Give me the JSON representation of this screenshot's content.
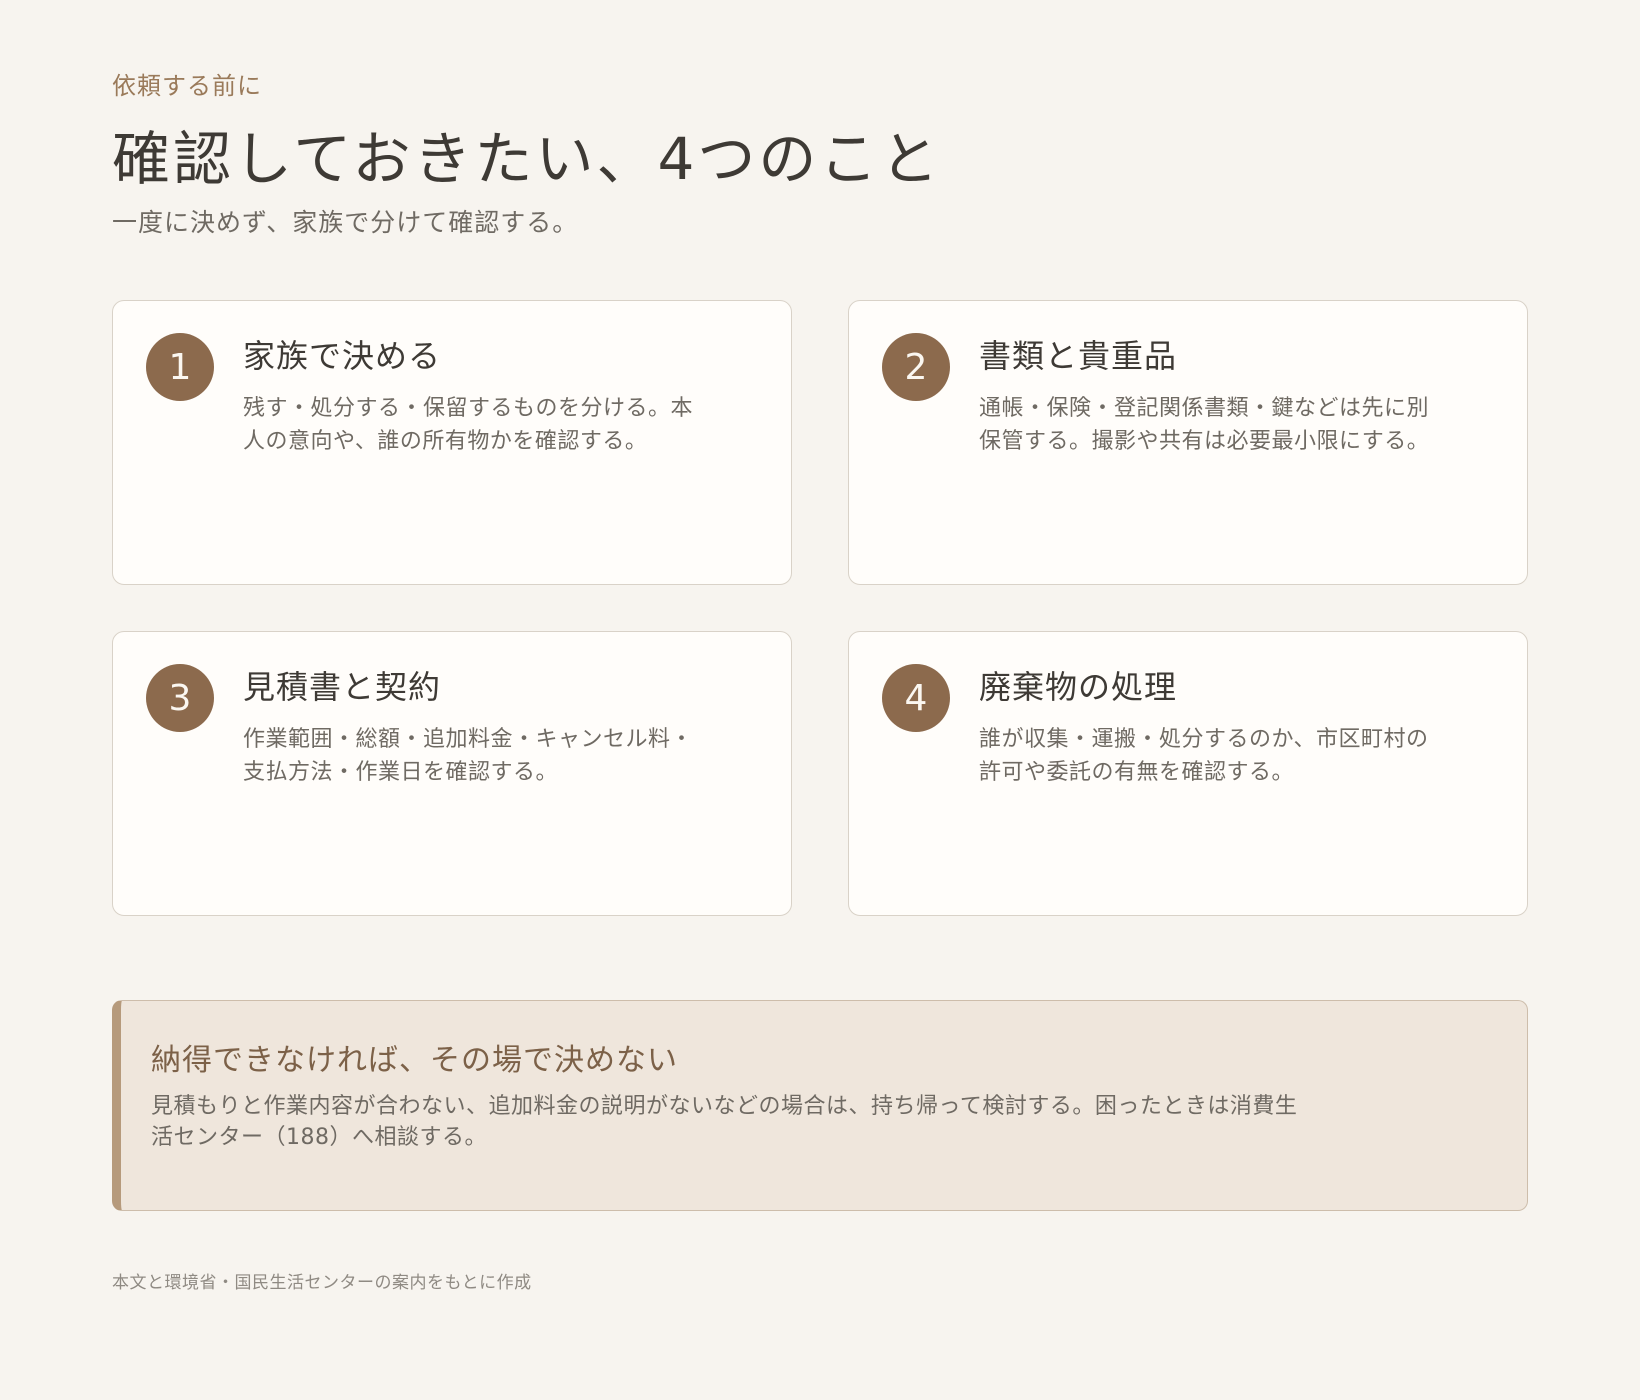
{
  "header": {
    "eyebrow": "依頼する前に",
    "title": "確認しておきたい、4つのこと",
    "subtitle": "一度に決めず、家族で分けて確認する。"
  },
  "cards": [
    {
      "number": "1",
      "title": "家族で決める",
      "body": "残す・処分する・保留するものを分ける。本人の意向や、誰の所有物かを確認する。"
    },
    {
      "number": "2",
      "title": "書類と貴重品",
      "body": "通帳・保険・登記関係書類・鍵などは先に別保管する。撮影や共有は必要最小限にする。"
    },
    {
      "number": "3",
      "title": "見積書と契約",
      "body": "作業範囲・総額・追加料金・キャンセル料・支払方法・作業日を確認する。"
    },
    {
      "number": "4",
      "title": "廃棄物の処理",
      "body": "誰が収集・運搬・処分するのか、市区町村の許可や委託の有無を確認する。"
    }
  ],
  "note": {
    "title": "納得できなければ、その場で決めない",
    "body": "見積もりと作業内容が合わない、追加料金の説明がないなどの場合は、持ち帰って検討する。困ったときは消費生活センター（188）へ相談する。"
  },
  "footer": {
    "source": "本文と環境省・国民生活センターの案内をもとに作成"
  },
  "colors": {
    "background": "#f7f4ef",
    "accent": "#8c6a4d",
    "note_background": "#efe6dc",
    "note_border": "#b69a7c"
  }
}
